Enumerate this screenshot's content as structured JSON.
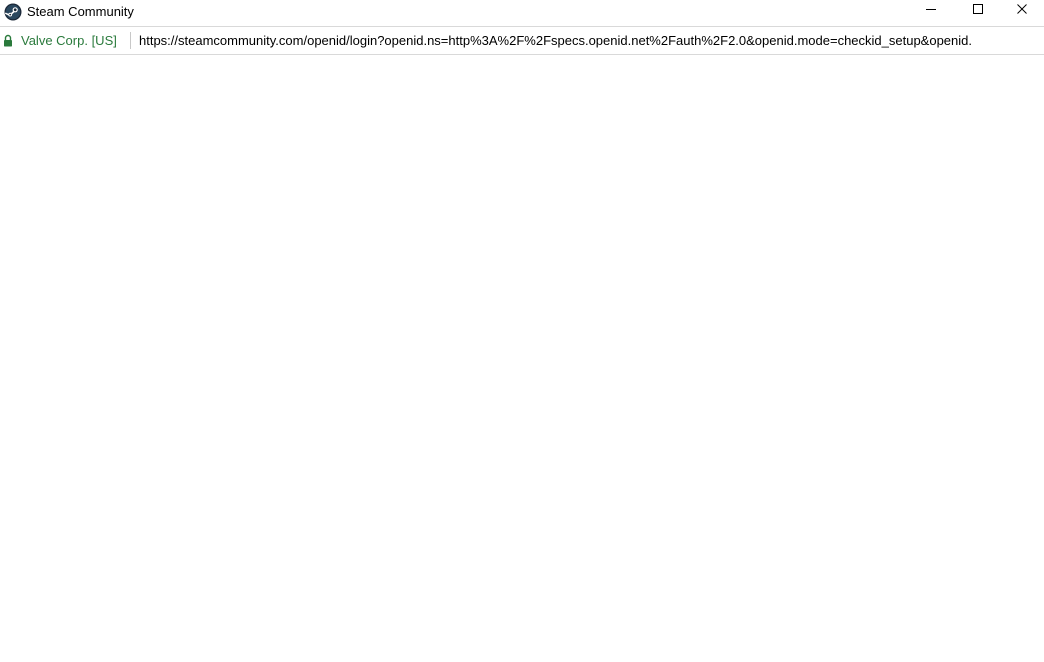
{
  "window": {
    "title": "Steam Community",
    "app_icon": "steam-icon",
    "controls": {
      "minimize_icon": "minimize-icon",
      "maximize_icon": "maximize-icon",
      "close_icon": "close-icon"
    }
  },
  "addressbar": {
    "lock_icon": "lock-icon",
    "identity": "Valve Corp. [US]",
    "url": "https://steamcommunity.com/openid/login?openid.ns=http%3A%2F%2Fspecs.openid.net%2Fauth%2F2.0&openid.mode=checkid_setup&openid.",
    "identity_color": "#2a7a3c"
  },
  "content": {}
}
